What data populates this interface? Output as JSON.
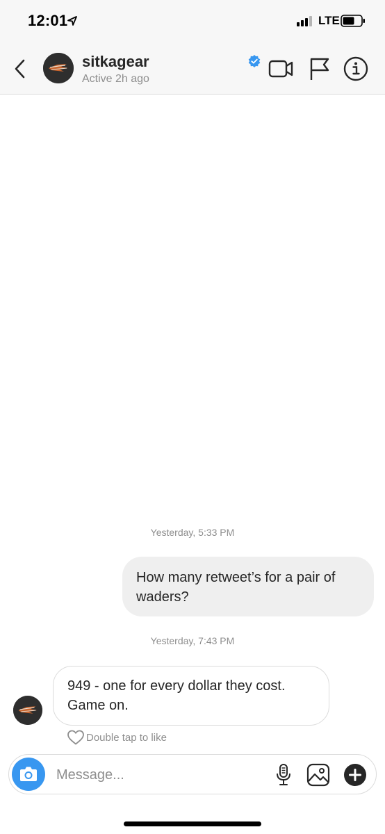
{
  "status_bar": {
    "time": "12:01",
    "network": "LTE"
  },
  "header": {
    "username": "sitkagear",
    "active_status": "Active 2h ago",
    "verified": true
  },
  "messages": [
    {
      "timestamp": "Yesterday, 5:33 PM",
      "direction": "outgoing",
      "text_line1": "How many retweet’s for a pair of",
      "text_line2": "waders?"
    },
    {
      "timestamp": "Yesterday, 7:43 PM",
      "direction": "incoming",
      "text_line1": "949 - one for every dollar they cost.",
      "text_line2": "Game on."
    }
  ],
  "like_hint": "Double tap to like",
  "composer": {
    "placeholder": "Message..."
  },
  "colors": {
    "accent": "#3897f0",
    "bubble_out": "#efefef",
    "header_bg": "#f7f7f7",
    "muted": "#8e8e8e"
  }
}
